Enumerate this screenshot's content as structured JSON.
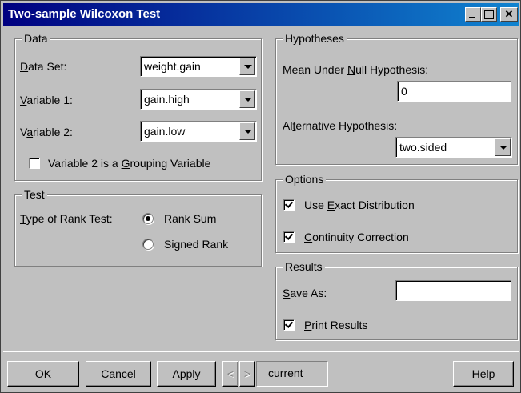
{
  "window": {
    "title": "Two-sample Wilcoxon Test"
  },
  "data_group": {
    "legend": "Data",
    "data_set": {
      "label": "Data Set:",
      "underline": "D",
      "rest": "ata Set:",
      "value": "weight.gain"
    },
    "variable1": {
      "label": "Variable 1:",
      "underline": "V",
      "rest": "ariable 1:",
      "value": "gain.high"
    },
    "variable2": {
      "pre": "V",
      "underline": "a",
      "rest": "riable 2:",
      "value": "gain.low"
    },
    "grouping": {
      "pre": "Variable 2 is a ",
      "underline": "G",
      "rest": "rouping Variable",
      "checked": false
    }
  },
  "test_group": {
    "legend": "Test",
    "type_label_u": "T",
    "type_label_rest": "ype of Rank Test:",
    "options": [
      "Rank Sum",
      "Signed Rank"
    ],
    "selected": "Rank Sum"
  },
  "hypotheses_group": {
    "legend": "Hypotheses",
    "null_pre": "Mean Under ",
    "null_u": "N",
    "null_rest": "ull Hypothesis:",
    "null_value": "0",
    "alt_pre": "Al",
    "alt_u": "t",
    "alt_rest": "ernative Hypothesis:",
    "alt_value": "two.sided"
  },
  "options_group": {
    "legend": "Options",
    "exact": {
      "pre": "Use ",
      "u": "E",
      "rest": "xact Distribution",
      "checked": true
    },
    "continuity": {
      "pre": "",
      "u": "C",
      "rest": "ontinuity Correction",
      "checked": true
    }
  },
  "results_group": {
    "legend": "Results",
    "save_u": "S",
    "save_rest": "ave As:",
    "save_value": "",
    "print": {
      "u": "P",
      "rest": "rint Results",
      "checked": true
    }
  },
  "buttons": {
    "ok": "OK",
    "cancel": "Cancel",
    "apply": "Apply",
    "prev": "<",
    "next": ">",
    "current": "current",
    "help": "Help"
  }
}
